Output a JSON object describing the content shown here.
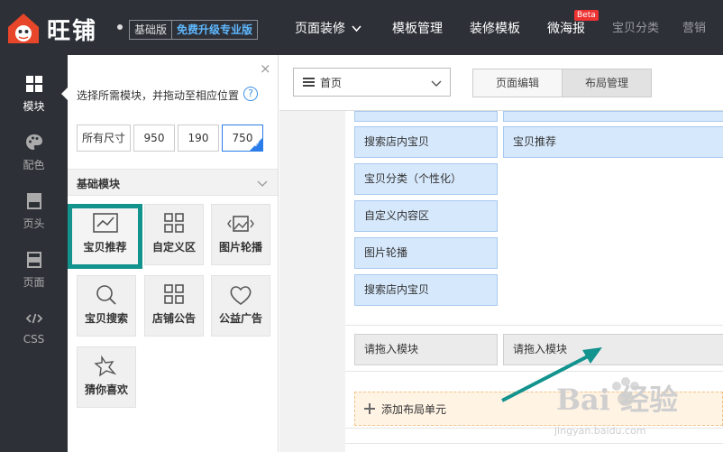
{
  "topbar": {
    "brand": "旺铺",
    "edition_basic": "基础版",
    "edition_upgrade": "免费升级专业版",
    "nav": [
      {
        "label": "页面装修",
        "has_dropdown": true
      },
      {
        "label": "模板管理"
      },
      {
        "label": "装修模板"
      },
      {
        "label": "微海报",
        "badge": "Beta"
      },
      {
        "label": "宝贝分类"
      },
      {
        "label": "营销"
      }
    ]
  },
  "rail": {
    "items": [
      {
        "label": "模块",
        "icon": "grid-icon",
        "active": true
      },
      {
        "label": "配色",
        "icon": "palette-icon"
      },
      {
        "label": "页头",
        "icon": "header-icon"
      },
      {
        "label": "页面",
        "icon": "page-icon"
      },
      {
        "label": "CSS",
        "icon": "code-icon"
      }
    ]
  },
  "panel": {
    "close": "×",
    "hint": "选择所需模块，并拖动至相应位置",
    "help": "?",
    "sizes": [
      {
        "label": "所有尺寸"
      },
      {
        "label": "950"
      },
      {
        "label": "190"
      },
      {
        "label": "750",
        "selected": true
      }
    ],
    "section_title": "基础模块",
    "modules": [
      {
        "label": "宝贝推荐",
        "icon": "chart-icon",
        "selected": true
      },
      {
        "label": "自定义区",
        "icon": "grid4-icon"
      },
      {
        "label": "图片轮播",
        "icon": "image-carousel-icon"
      },
      {
        "label": "宝贝搜索",
        "icon": "search-icon"
      },
      {
        "label": "店铺公告",
        "icon": "grid4-icon"
      },
      {
        "label": "公益广告",
        "icon": "heart-icon"
      },
      {
        "label": "猜你喜欢",
        "icon": "sparkle-icon"
      }
    ]
  },
  "editor": {
    "page_select_value": "首页",
    "tabs": [
      {
        "label": "页面编辑"
      },
      {
        "label": "布局管理",
        "active": true
      }
    ],
    "left_blocks": [
      "搜索店内宝贝",
      "宝贝分类（个性化）",
      "自定义内容区",
      "图片轮播",
      "搜索店内宝贝"
    ],
    "right_blocks": [
      "宝贝推荐"
    ],
    "drop_cells": [
      "请拖入模块",
      "请拖入模块"
    ],
    "add_unit": "添加布局单元"
  },
  "watermark": {
    "text": "Bai 经验",
    "sub": "jingyan.baidu.com"
  },
  "colors": {
    "topbar": "#2d3037",
    "accent_teal": "#13938e",
    "module_blue": "#d6e8fc",
    "link_blue": "#5fb8ff",
    "beta_red": "#ee3333"
  }
}
